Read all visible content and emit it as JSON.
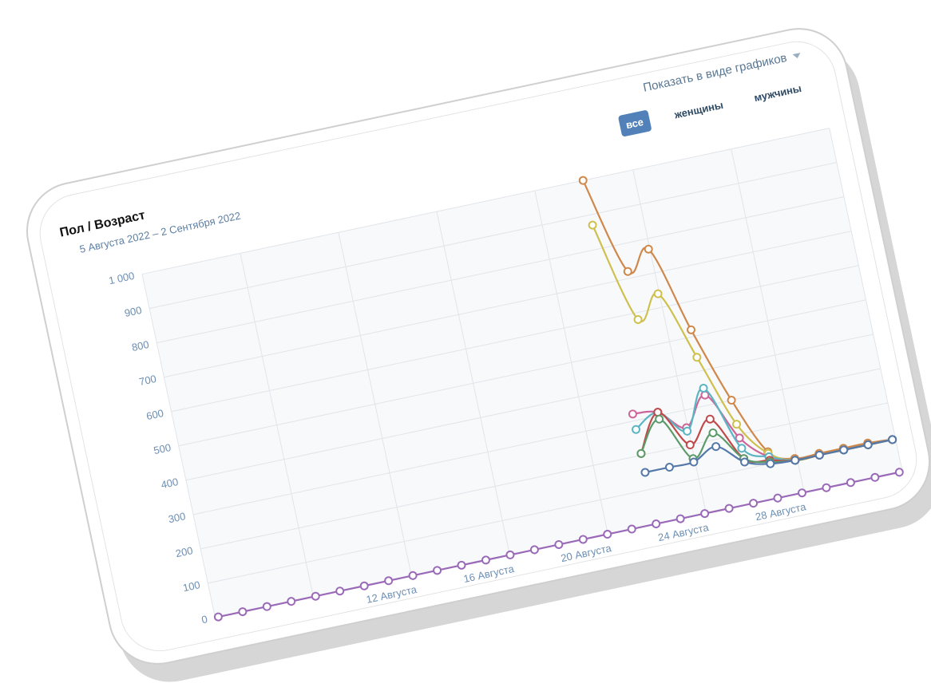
{
  "widget": {
    "title": "Пол / Возраст",
    "date_range": "5 Августа 2022 – 2 Сентября 2022",
    "display_mode": "Показать в виде графиков",
    "filters": [
      "все",
      "женщины",
      "мужчины"
    ],
    "active_filter": "все"
  },
  "chart_data": {
    "type": "line",
    "x_axis": {
      "type": "date",
      "start": "2022-08-05",
      "end": "2022-09-02",
      "ticks": [
        "12 Августа",
        "16 Августа",
        "20 Августа",
        "24 Августа",
        "28 Августа"
      ]
    },
    "y_axis": {
      "ylim": [
        0,
        1000
      ],
      "ticks": [
        "0",
        "100",
        "200",
        "300",
        "400",
        "500",
        "600",
        "700",
        "800",
        "900",
        "1 000"
      ]
    },
    "grid": true,
    "legend": "none",
    "x": [
      "2022-08-05",
      "2022-08-06",
      "2022-08-07",
      "2022-08-08",
      "2022-08-09",
      "2022-08-10",
      "2022-08-11",
      "2022-08-12",
      "2022-08-13",
      "2022-08-14",
      "2022-08-15",
      "2022-08-16",
      "2022-08-17",
      "2022-08-18",
      "2022-08-19",
      "2022-08-20",
      "2022-08-21",
      "2022-08-22",
      "2022-08-23",
      "2022-08-24",
      "2022-08-25",
      "2022-08-26",
      "2022-08-27",
      "2022-08-28",
      "2022-08-29",
      "2022-08-30",
      "2022-08-31",
      "2022-09-01",
      "2022-09-02"
    ],
    "series": [
      {
        "color": "#d0884a",
        "values": [
          null,
          null,
          null,
          null,
          null,
          null,
          null,
          null,
          null,
          null,
          null,
          null,
          null,
          null,
          null,
          null,
          null,
          null,
          1000,
          720,
          770,
          520,
          300,
          135,
          100,
          100,
          100,
          100,
          95
        ]
      },
      {
        "color": "#cfc04e",
        "values": [
          null,
          null,
          null,
          null,
          null,
          null,
          null,
          null,
          null,
          null,
          null,
          null,
          null,
          null,
          null,
          null,
          null,
          null,
          870,
          580,
          640,
          440,
          230,
          130,
          95,
          95,
          95,
          95,
          95
        ]
      },
      {
        "color": "#cc6699",
        "values": [
          null,
          null,
          null,
          null,
          null,
          null,
          null,
          null,
          null,
          null,
          null,
          null,
          null,
          null,
          null,
          null,
          null,
          null,
          320,
          310,
          250,
          330,
          190,
          120,
          95,
          95,
          95,
          95,
          95
        ]
      },
      {
        "color": "#5bb4c4",
        "values": [
          null,
          null,
          null,
          null,
          null,
          null,
          null,
          null,
          null,
          null,
          null,
          null,
          null,
          null,
          null,
          null,
          null,
          null,
          275,
          310,
          240,
          350,
          160,
          120,
          95,
          95,
          95,
          95,
          95
        ]
      },
      {
        "color": "#c04a4a",
        "values": [
          null,
          null,
          null,
          null,
          null,
          null,
          null,
          null,
          null,
          null,
          null,
          null,
          null,
          null,
          null,
          null,
          null,
          null,
          205,
          310,
          200,
          260,
          130,
          110,
          95,
          95,
          95,
          95,
          95
        ]
      },
      {
        "color": "#5c9a6a",
        "values": [
          null,
          null,
          null,
          null,
          null,
          null,
          null,
          null,
          null,
          null,
          null,
          null,
          null,
          null,
          null,
          null,
          null,
          null,
          205,
          290,
          160,
          220,
          130,
          105,
          95,
          95,
          95,
          95,
          95
        ]
      },
      {
        "color": "#5578a8",
        "values": [
          null,
          null,
          null,
          null,
          null,
          null,
          null,
          null,
          null,
          null,
          null,
          null,
          null,
          null,
          null,
          null,
          null,
          null,
          150,
          150,
          150,
          180,
          120,
          100,
          95,
          95,
          95,
          95,
          95
        ]
      },
      {
        "color": "#9a6ab8",
        "values": [
          0,
          0,
          0,
          0,
          0,
          0,
          0,
          0,
          0,
          0,
          0,
          0,
          0,
          0,
          0,
          0,
          0,
          0,
          0,
          0,
          0,
          0,
          0,
          0,
          0,
          0,
          0,
          0,
          0
        ]
      }
    ]
  }
}
